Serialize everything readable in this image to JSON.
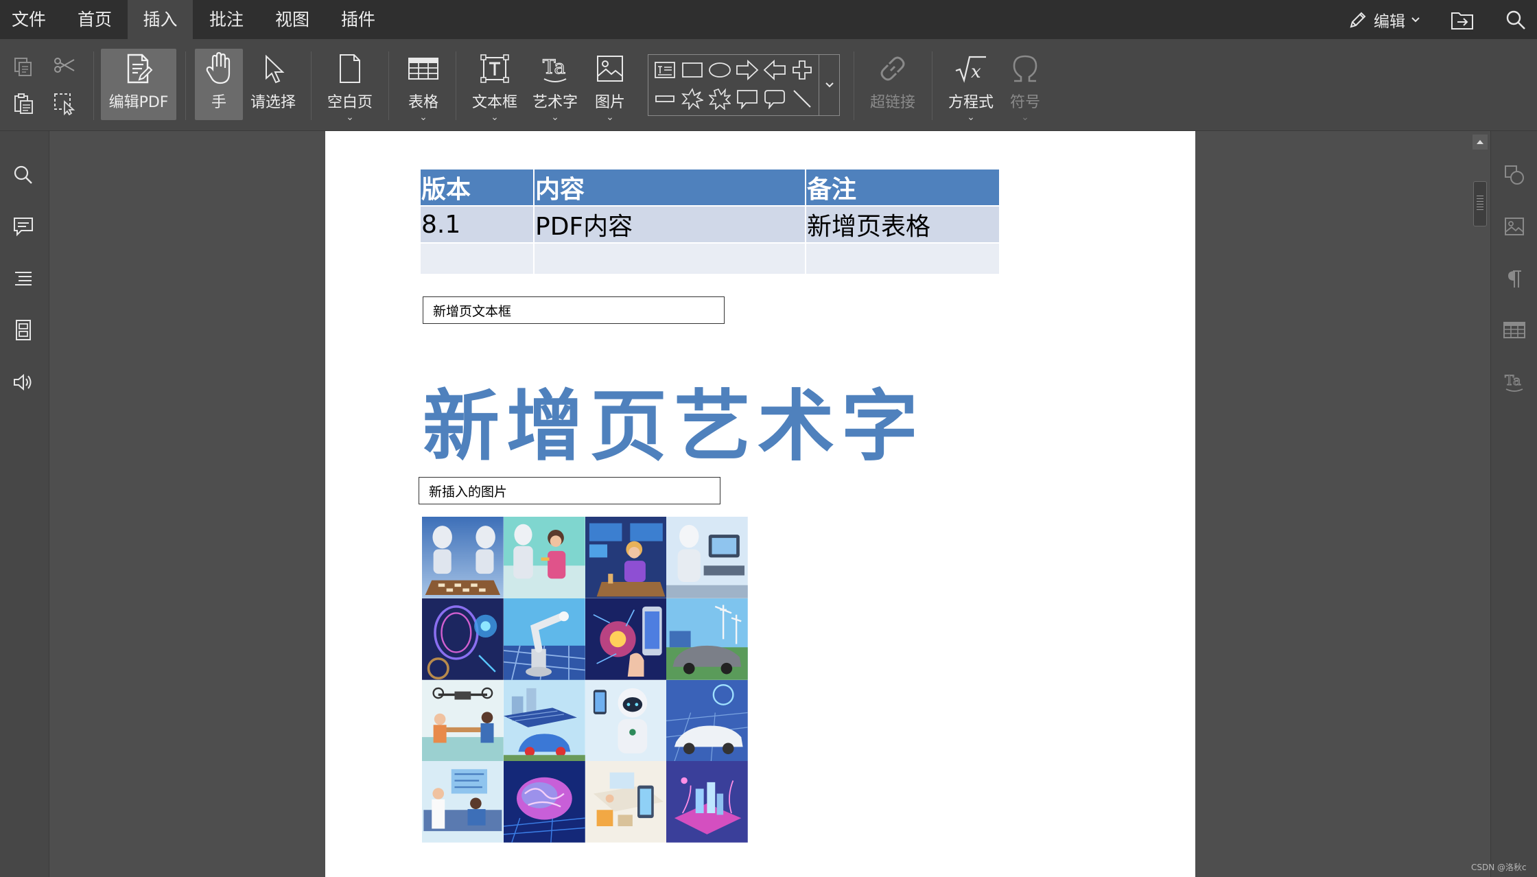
{
  "menubar": {
    "items": [
      "文件",
      "首页",
      "插入",
      "批注",
      "视图",
      "插件"
    ],
    "active": "插入",
    "edit_label": "编辑"
  },
  "toolbar": {
    "edit_pdf": "编辑PDF",
    "hand": "手",
    "select": "请选择",
    "blank_page": "空白页",
    "table": "表格",
    "textbox": "文本框",
    "wordart": "艺术字",
    "image": "图片",
    "hyperlink": "超链接",
    "equation": "方程式",
    "symbol": "符号"
  },
  "document": {
    "table": {
      "headers": [
        "版本",
        "内容",
        "备注"
      ],
      "rows": [
        [
          "8.1",
          "PDF内容",
          "新增页表格"
        ],
        [
          "",
          "",
          ""
        ]
      ]
    },
    "textbox1": "新增页文本框",
    "wordart": "新增页艺术字",
    "textbox2": "新插入的图片",
    "image_alt": "AI illustration collage"
  },
  "watermark": "CSDN @洛秋c",
  "colors": {
    "table_header": "#4f81bd",
    "table_row1": "#d0d8e8",
    "table_row2": "#e9edf4",
    "wordart": "#4f81bd"
  }
}
